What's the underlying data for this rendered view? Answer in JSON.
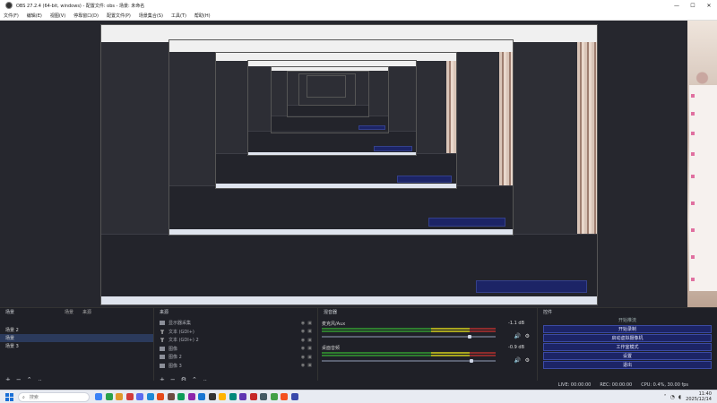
{
  "window": {
    "title": "OBS 27.2.4 (64-bit, windows) - 配置文件: obs - 场景: 未命名",
    "controls": [
      "—",
      "☐",
      "✕"
    ]
  },
  "menu": [
    "文件(F)",
    "编辑(E)",
    "视图(V)",
    "停靠窗口(D)",
    "配置文件(P)",
    "场景集合(S)",
    "工具(T)",
    "帮助(H)"
  ],
  "scenes": {
    "title": "场景",
    "tabs": [
      "场景",
      "来源"
    ],
    "items": [
      "场景 2",
      "场景",
      "场景 3"
    ],
    "selected_index": 1,
    "footer": [
      "+",
      "−",
      "⌃",
      "⌄"
    ]
  },
  "sources": {
    "title": "来源",
    "items": [
      {
        "icon": "image",
        "label": "显示器采集"
      },
      {
        "icon": "text",
        "label": "文本 (GDI+)"
      },
      {
        "icon": "text",
        "label": "文本 (GDI+) 2"
      },
      {
        "icon": "image",
        "label": "图像"
      },
      {
        "icon": "image",
        "label": "图像 2"
      },
      {
        "icon": "image",
        "label": "图像 3"
      }
    ],
    "footer": [
      "+",
      "−",
      "⚙",
      "⌃",
      "⌄"
    ]
  },
  "mixer": {
    "title": "混音器",
    "tracks": [
      {
        "name": "麦克风/Aux",
        "db": "-1.1 dB",
        "level": 0.85
      },
      {
        "name": "桌面音频",
        "db": "-0.9 dB",
        "level": 0.86
      }
    ]
  },
  "controls": {
    "title": "控件",
    "buttons": [
      "开始推流",
      "开始录制",
      "启动虚拟摄像机",
      "工作室模式",
      "设置",
      "退出"
    ]
  },
  "status": {
    "live": "LIVE: 00:00:00",
    "rec": "REC: 00:00:00",
    "cpu": "CPU: 0.4%, 30.00 fps"
  },
  "taskbar": {
    "search_label": "搜索",
    "time": "11:40",
    "date": "2025/12/14",
    "icon_colors": [
      "#3b82f6",
      "#2aa14b",
      "#e0982b",
      "#d23b3b",
      "#5b6cf0",
      "#1f8ad6",
      "#e64a19",
      "#6d4c41",
      "#0f9d58",
      "#8e24aa",
      "#1976d2",
      "#333333",
      "#ffb300",
      "#00897b",
      "#5e35b1",
      "#c62828",
      "#455a64",
      "#43a047",
      "#f4511e",
      "#3949ab"
    ]
  }
}
